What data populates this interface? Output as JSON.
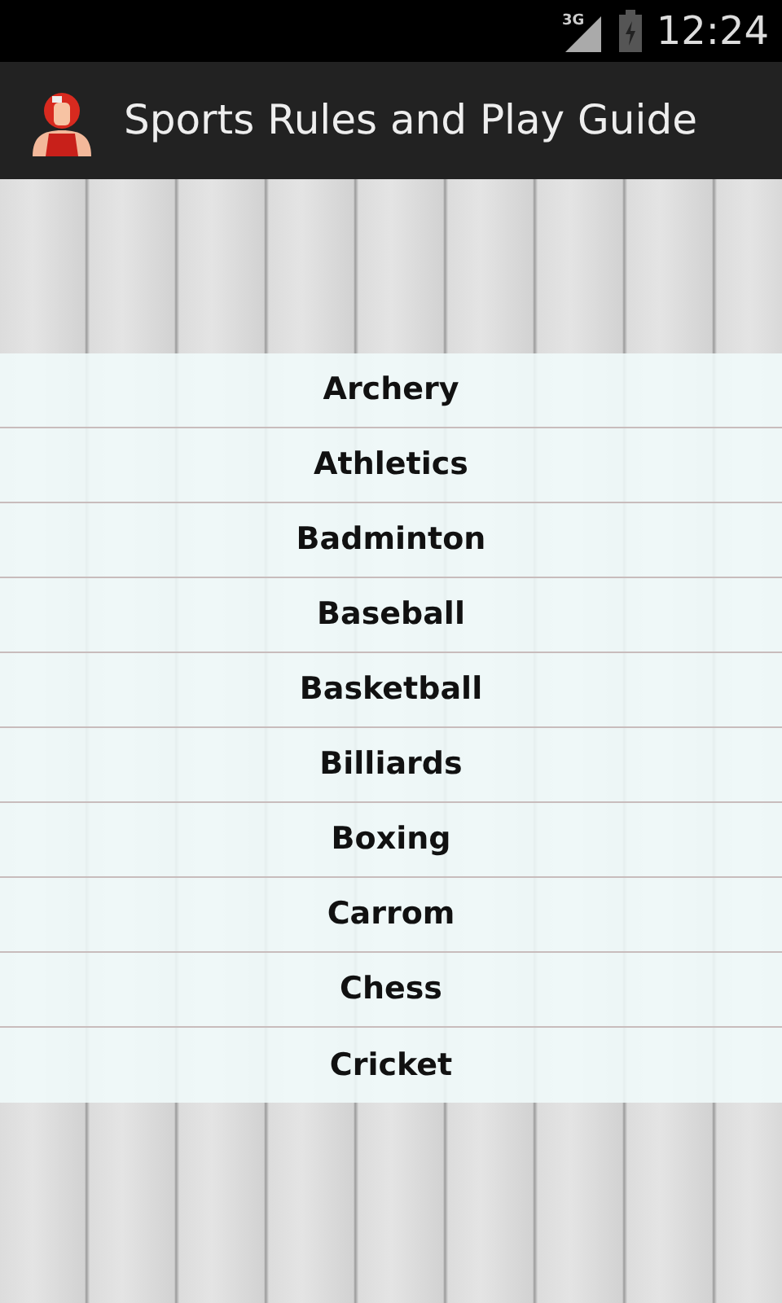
{
  "status_bar": {
    "network": "3G",
    "time": "12:24"
  },
  "action_bar": {
    "title": "Sports Rules and Play Guide"
  },
  "sports": [
    {
      "label": "Archery"
    },
    {
      "label": "Athletics"
    },
    {
      "label": "Badminton"
    },
    {
      "label": "Baseball"
    },
    {
      "label": "Basketball"
    },
    {
      "label": "Billiards"
    },
    {
      "label": "Boxing"
    },
    {
      "label": "Carrom"
    },
    {
      "label": "Chess"
    },
    {
      "label": "Cricket"
    }
  ]
}
